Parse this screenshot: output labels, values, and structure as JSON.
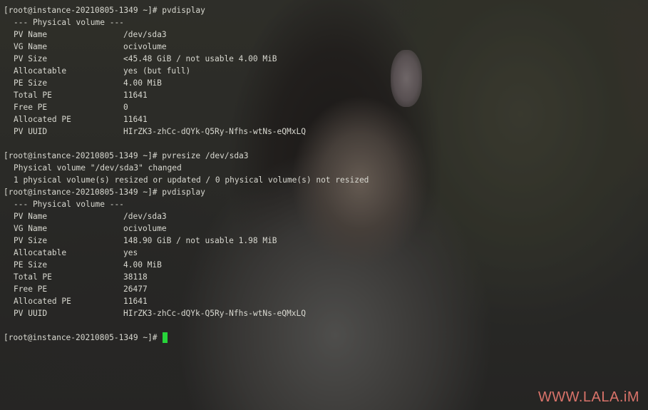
{
  "terminal": {
    "prompt": "[root@instance-20210805-1349 ~]# ",
    "block1": {
      "command": "pvdisplay",
      "header": "--- Physical volume ---",
      "fields": [
        {
          "label": "PV Name",
          "value": "/dev/sda3"
        },
        {
          "label": "VG Name",
          "value": "ocivolume"
        },
        {
          "label": "PV Size",
          "value": "<45.48 GiB / not usable 4.00 MiB"
        },
        {
          "label": "Allocatable",
          "value": "yes (but full)"
        },
        {
          "label": "PE Size",
          "value": "4.00 MiB"
        },
        {
          "label": "Total PE",
          "value": "11641"
        },
        {
          "label": "Free PE",
          "value": "0"
        },
        {
          "label": "Allocated PE",
          "value": "11641"
        },
        {
          "label": "PV UUID",
          "value": "HIrZK3-zhCc-dQYk-Q5Ry-Nfhs-wtNs-eQMxLQ"
        }
      ]
    },
    "block2": {
      "command": "pvresize /dev/sda3",
      "output": [
        "Physical volume \"/dev/sda3\" changed",
        "1 physical volume(s) resized or updated / 0 physical volume(s) not resized"
      ]
    },
    "block3": {
      "command": "pvdisplay",
      "header": "--- Physical volume ---",
      "fields": [
        {
          "label": "PV Name",
          "value": "/dev/sda3"
        },
        {
          "label": "VG Name",
          "value": "ocivolume"
        },
        {
          "label": "PV Size",
          "value": "148.90 GiB / not usable 1.98 MiB"
        },
        {
          "label": "Allocatable",
          "value": "yes"
        },
        {
          "label": "PE Size",
          "value": "4.00 MiB"
        },
        {
          "label": "Total PE",
          "value": "38118"
        },
        {
          "label": "Free PE",
          "value": "26477"
        },
        {
          "label": "Allocated PE",
          "value": "11641"
        },
        {
          "label": "PV UUID",
          "value": "HIrZK3-zhCc-dQYk-Q5Ry-Nfhs-wtNs-eQMxLQ"
        }
      ]
    },
    "cursor_color": "#27d43a"
  },
  "watermark": "WWW.LALA.iM",
  "colors": {
    "text": "#d8d8d0",
    "watermark": "#d9736a"
  }
}
